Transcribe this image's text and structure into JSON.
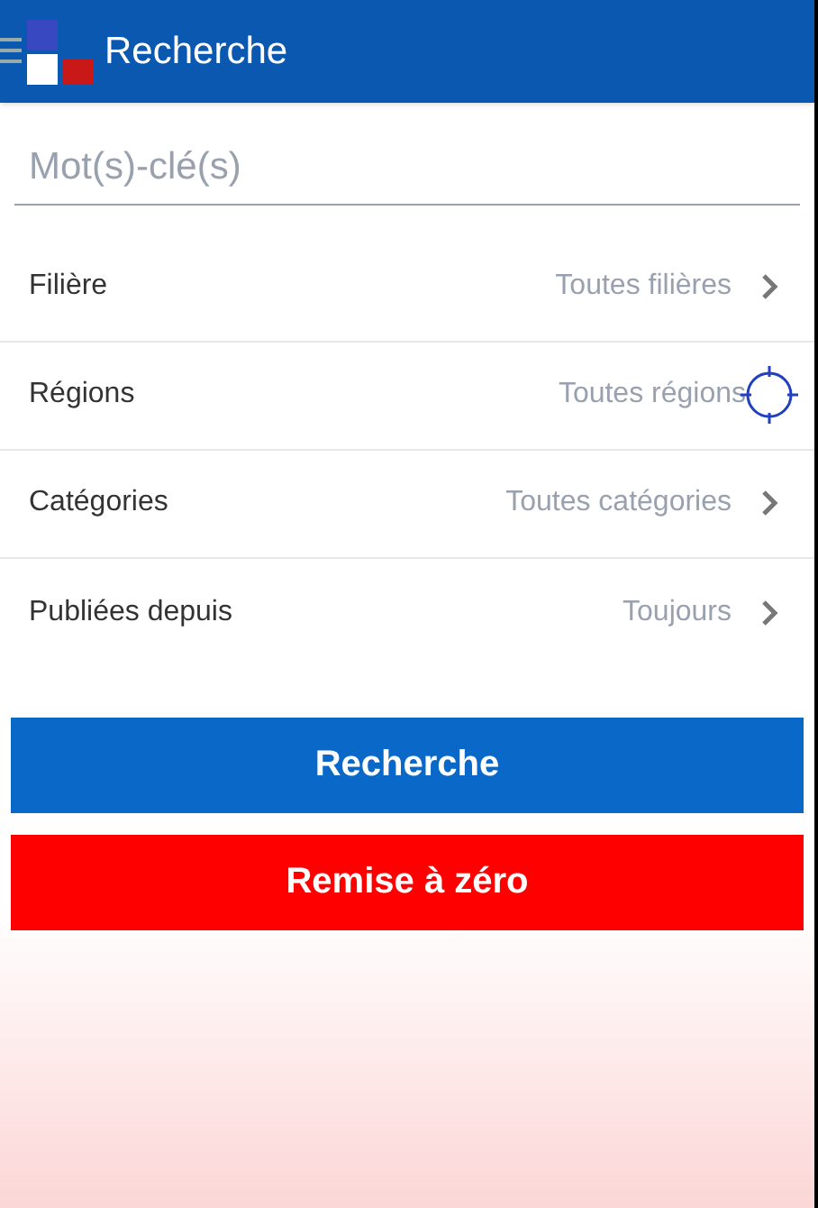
{
  "app_bar": {
    "title": "Recherche"
  },
  "search": {
    "placeholder": "Mot(s)-clé(s)"
  },
  "filters": [
    {
      "label": "Filière",
      "value": "Toutes filières",
      "kind": "chevron"
    },
    {
      "label": "Régions",
      "value": "Toutes régions",
      "kind": "locate"
    },
    {
      "label": "Catégories",
      "value": "Toutes catégories",
      "kind": "chevron"
    },
    {
      "label": "Publiées depuis",
      "value": "Toujours",
      "kind": "chevron"
    }
  ],
  "buttons": [
    {
      "label": "Recherche",
      "kind": "primary"
    },
    {
      "label": "Remise à zéro",
      "kind": "danger"
    }
  ]
}
